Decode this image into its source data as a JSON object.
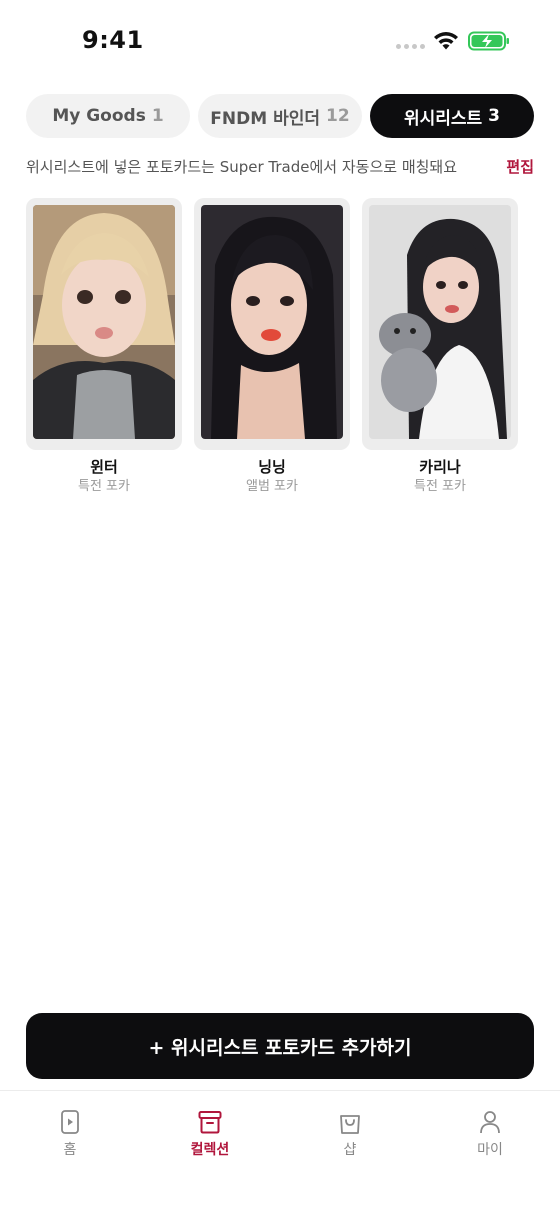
{
  "status_bar": {
    "time": "9:41"
  },
  "tabs": [
    {
      "label": "My Goods",
      "count": "1",
      "active": false
    },
    {
      "label": "FNDM 바인더",
      "count": "12",
      "active": false
    },
    {
      "label": "위시리스트",
      "count": "3",
      "active": true
    }
  ],
  "notice": {
    "text": "위시리스트에 넣은 포토카드는 Super Trade에서 자동으로 매칭돼요",
    "edit_label": "편집"
  },
  "cards": [
    {
      "name": "윈터",
      "type": "특전 포카"
    },
    {
      "name": "닝닝",
      "type": "앨범 포카"
    },
    {
      "name": "카리나",
      "type": "특전 포카"
    }
  ],
  "add_button_label": "+ 위시리스트 포토카드 추가하기",
  "bottom_nav": [
    {
      "label": "홈",
      "icon": "phone-play-icon",
      "active": false
    },
    {
      "label": "컬렉션",
      "icon": "archive-box-icon",
      "active": true
    },
    {
      "label": "샵",
      "icon": "shopping-bag-icon",
      "active": false
    },
    {
      "label": "마이",
      "icon": "person-icon",
      "active": false
    }
  ],
  "colors": {
    "accent": "#b0163c",
    "active_tab": "#0d0d0f",
    "battery": "#34c759"
  }
}
